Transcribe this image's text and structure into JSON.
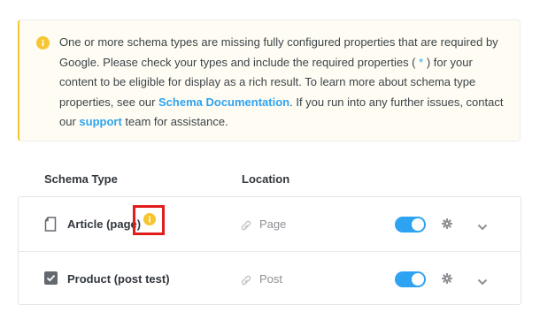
{
  "notice": {
    "icon": "info-icon",
    "icon_color": "#f7c531",
    "text_1": "One or more schema types are missing fully configured properties that are required by Google. Please check your types and include the required properties (",
    "required_marker": " * ",
    "text_2": ") for your content to be eligible for display as a rich result. To learn more about schema type properties, see our ",
    "link_schema_docs": "Schema Documentation",
    "text_3": ". If you run into any further issues, contact our ",
    "link_support": "support",
    "text_4": " team for assistance."
  },
  "table": {
    "headers": {
      "schema_type": "Schema Type",
      "location": "Location"
    },
    "rows": [
      {
        "icon": "page-icon",
        "name": "Article (page)",
        "warning_icon": "info-warning-icon",
        "location_icon": "link-icon",
        "location": "Page",
        "enabled": true,
        "settings_icon": "gear-icon",
        "expand_icon": "chevron-down-icon"
      },
      {
        "icon": "product-checkbox-icon",
        "name": "Product (post test)",
        "location_icon": "link-icon",
        "location": "Post",
        "enabled": true,
        "settings_icon": "gear-icon",
        "expand_icon": "chevron-down-icon"
      }
    ]
  },
  "colors": {
    "accent": "#2ea3f2",
    "warning": "#f7c531",
    "highlight_box": "#e21b1b"
  }
}
